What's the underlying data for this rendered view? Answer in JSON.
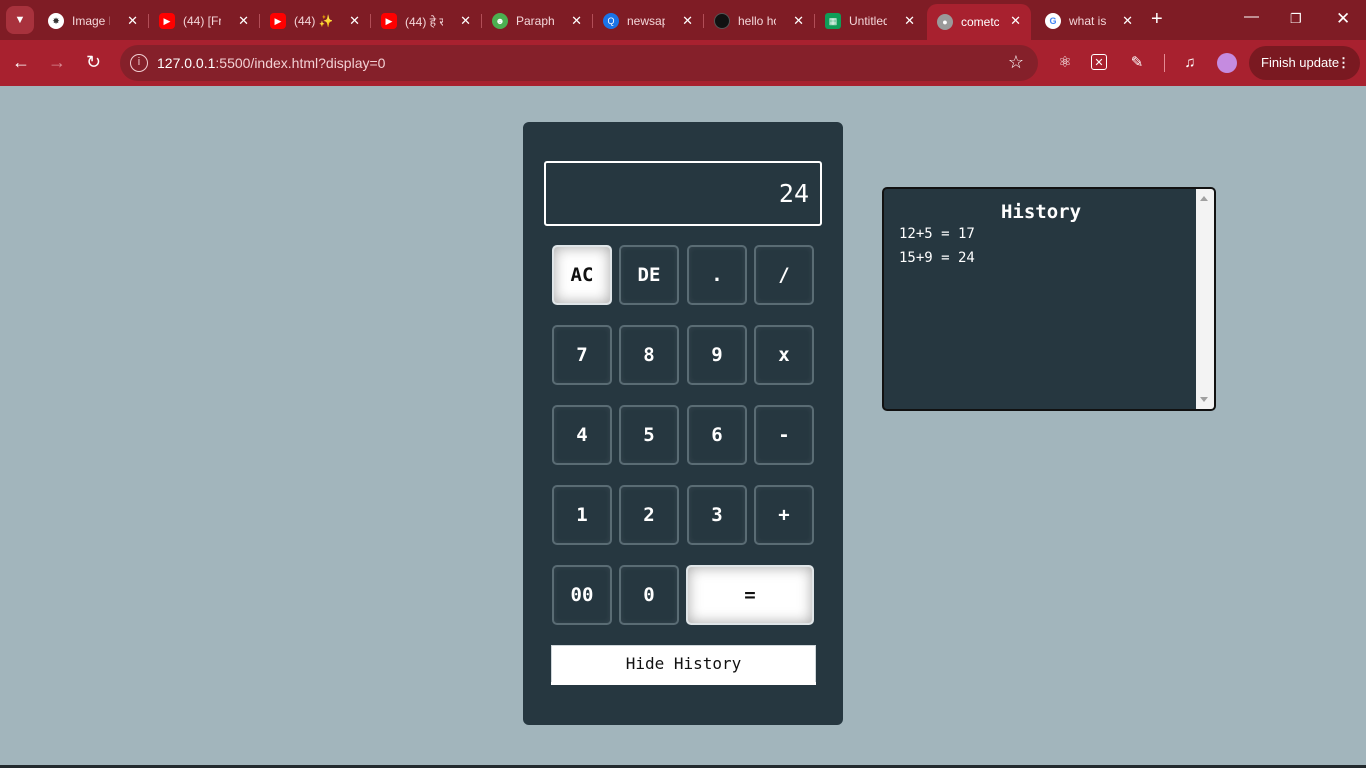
{
  "browser": {
    "tabs": [
      {
        "title": "Image I",
        "icon": "openai-icon",
        "color": "#ffffff",
        "active": false
      },
      {
        "title": "(44) [Fr",
        "icon": "youtube-icon",
        "color": "#ff0000",
        "active": false
      },
      {
        "title": "(44) ✨",
        "icon": "youtube-icon",
        "color": "#ff0000",
        "active": false
      },
      {
        "title": "(44) हे र",
        "icon": "youtube-icon",
        "color": "#ff0000",
        "active": false
      },
      {
        "title": "Paraphr",
        "icon": "robot-icon",
        "color": "#4caf50",
        "active": false
      },
      {
        "title": "newsap",
        "icon": "q-icon",
        "color": "#1a73e8",
        "active": false
      },
      {
        "title": "hello ho",
        "icon": "dark-circle-icon",
        "color": "#111111",
        "active": false
      },
      {
        "title": "Untitled",
        "icon": "sheets-icon",
        "color": "#0f9d58",
        "active": false
      },
      {
        "title": "cometc",
        "icon": "globe-icon",
        "color": "#bbbbbb",
        "active": true
      },
      {
        "title": "what is",
        "icon": "google-icon",
        "color": "#ffffff",
        "active": false
      }
    ],
    "url_host": "127.0.0.1",
    "url_rest": ":5500/index.html?display=0",
    "finish_update_label": "Finish update",
    "accent_color": "#a8212f"
  },
  "calculator": {
    "display_value": "24",
    "keys": {
      "ac": "AC",
      "de": "DE",
      "dot": ".",
      "divide": "/",
      "seven": "7",
      "eight": "8",
      "nine": "9",
      "multiply": "x",
      "four": "4",
      "five": "5",
      "six": "6",
      "minus": "-",
      "one": "1",
      "two": "2",
      "three": "3",
      "plus": "+",
      "double_zero": "00",
      "zero": "0",
      "equals": "="
    },
    "hide_history_label": "Hide History"
  },
  "history": {
    "title": "History",
    "entries": [
      "12+5 = 17",
      "15+9 = 24"
    ]
  }
}
